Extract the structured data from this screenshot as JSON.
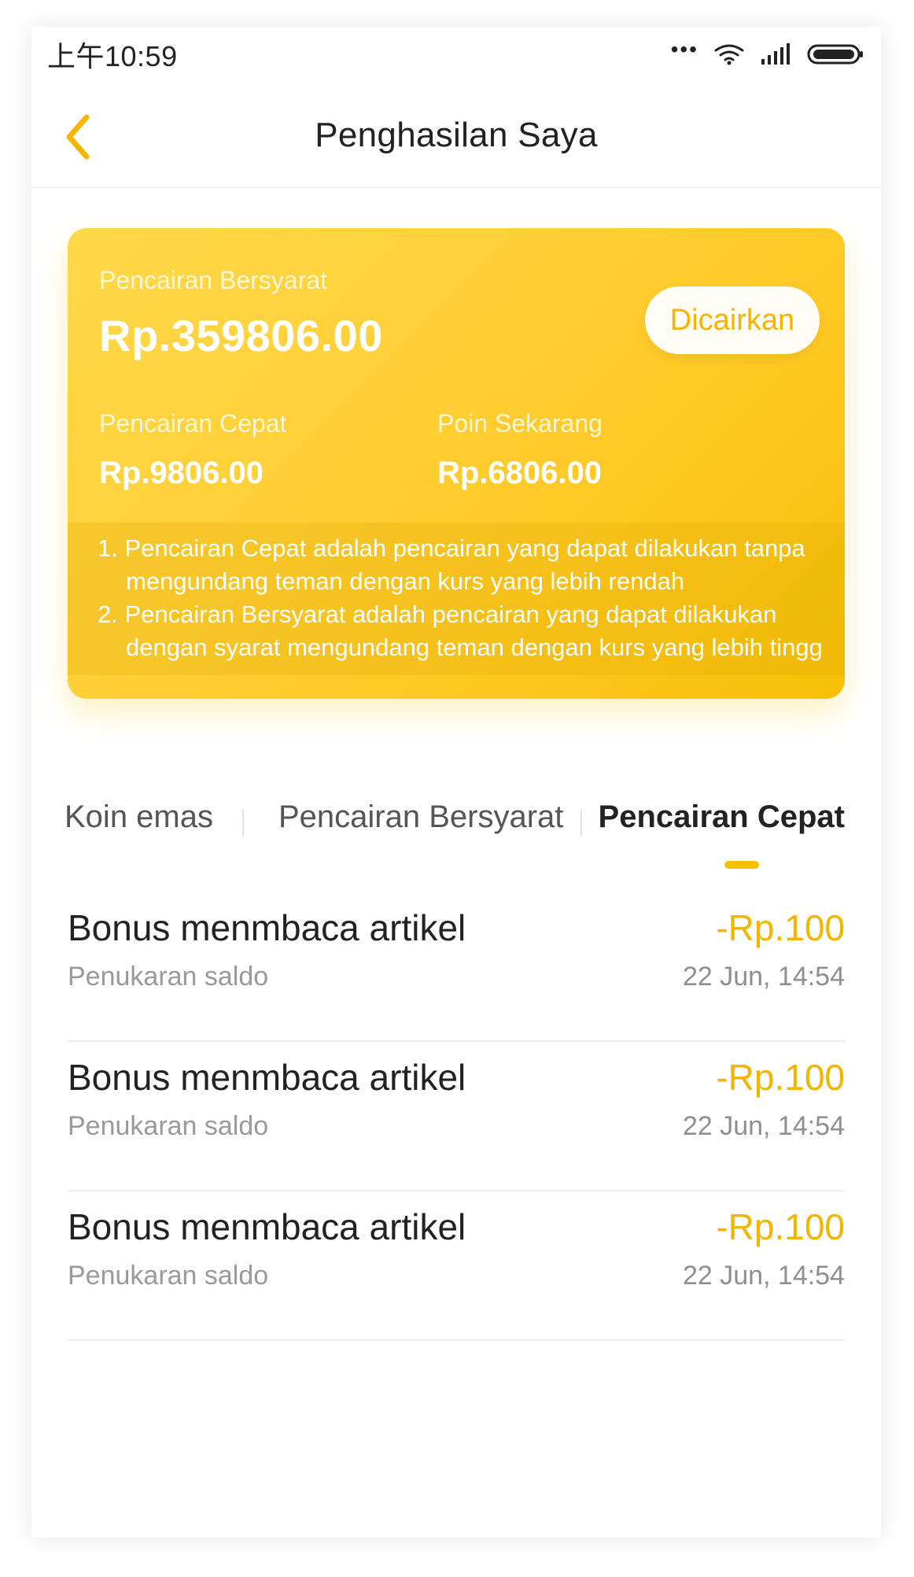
{
  "status_bar": {
    "time": "上午10:59",
    "icons": {
      "more": "more-icon",
      "wifi": "wifi-icon",
      "signal": "signal-icon",
      "battery": "battery-icon"
    }
  },
  "header": {
    "back_icon": "chevron-left-icon",
    "title": "Penghasilan Saya"
  },
  "card": {
    "primary_label": "Pencairan Bersyarat",
    "primary_amount": "Rp.359806.00",
    "withdraw_button": "Dicairkan",
    "secondary_left_label": "Pencairan Cepat",
    "secondary_left_amount": "Rp.9806.00",
    "secondary_right_label": "Poin Sekarang",
    "secondary_right_amount": "Rp.6806.00",
    "notes": [
      "1. Pencairan Cepat adalah pencairan yang dapat dilakukan tanpa",
      "mengundang teman dengan kurs yang lebih rendah",
      "2. Pencairan Bersyarat adalah pencairan yang dapat dilakukan",
      "dengan syarat mengundang teman dengan kurs yang lebih tinggi"
    ]
  },
  "tabs": [
    {
      "label": "Koin emas"
    },
    {
      "label": "Pencairan Bersyarat"
    },
    {
      "label": "Pencairan Cepat"
    }
  ],
  "transactions": [
    {
      "title": "Bonus menmbaca artikel",
      "subtitle": "Penukaran saldo",
      "amount": "-Rp.100",
      "time": "22 Jun, 14:54"
    },
    {
      "title": "Bonus menmbaca artikel",
      "subtitle": "Penukaran saldo",
      "amount": "-Rp.100",
      "time": "22 Jun, 14:54"
    },
    {
      "title": "Bonus menmbaca artikel",
      "subtitle": "Penukaran saldo",
      "amount": "-Rp.100",
      "time": "22 Jun, 14:54"
    }
  ],
  "colors": {
    "accent": "#F7C000",
    "card_start": "#FFD84A",
    "card_end": "#F7C007",
    "text_primary": "#222222",
    "text_secondary": "#9A9A9A"
  }
}
